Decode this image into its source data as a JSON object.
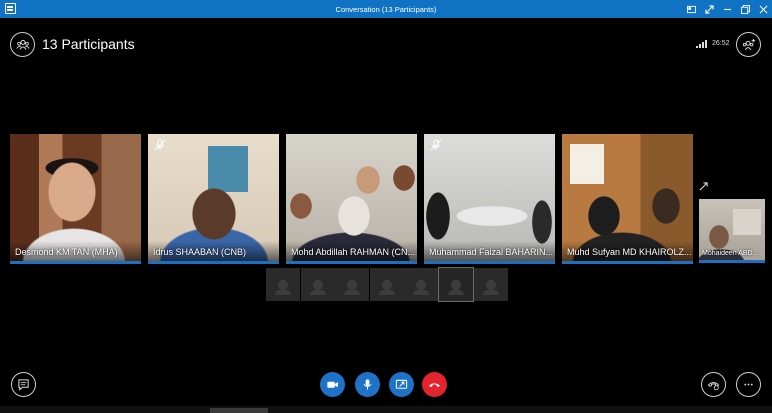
{
  "window": {
    "title": "Conversation (13 Participants)"
  },
  "header": {
    "participants_label": "13 Participants",
    "call_timer": "26:52"
  },
  "video_tiles": [
    {
      "name": "Desmond KM TAN (MHA)",
      "muted": false
    },
    {
      "name": "Idrus SHAABAN (CNB)",
      "muted": true
    },
    {
      "name": "Mohd Abdillah RAHMAN (CN...",
      "muted": false
    },
    {
      "name": "Muhammad Faizal BAHARIN...",
      "muted": true
    },
    {
      "name": "Muhd Sufyan MD KHAIROLZ...",
      "muted": false
    }
  ],
  "small_tile": {
    "name": "Mohaideen ABD..."
  },
  "thumbnails": [
    {
      "selected": false
    },
    {
      "selected": false
    },
    {
      "selected": false
    },
    {
      "selected": false
    },
    {
      "selected": false
    },
    {
      "selected": true
    },
    {
      "selected": false
    }
  ],
  "controls": {
    "accent_blue": "#1e73c8",
    "hangup_red": "#e3232d",
    "icons": [
      "chat-icon",
      "video-camera-icon",
      "microphone-icon",
      "share-screen-icon",
      "hang-up-icon",
      "call-devices-icon",
      "more-icon"
    ]
  }
}
